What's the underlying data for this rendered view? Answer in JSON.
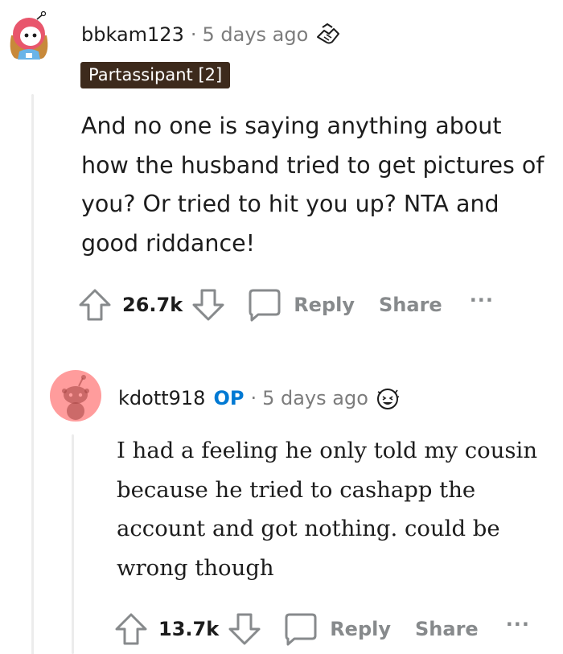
{
  "comments": [
    {
      "username": "bbkam123",
      "separator": "·",
      "timestamp": "5 days ago",
      "award_icon": "handshake-award-icon",
      "flair": "Partassipant [2]",
      "body": "And no one is saying anything about how the husband tried to get pictures of you? Or tried to hit you up? NTA and good riddance!",
      "score": "26.7k",
      "reply_label": "Reply",
      "share_label": "Share",
      "more_label": "···"
    },
    {
      "username": "kdott918",
      "op_badge": "OP",
      "separator": "·",
      "timestamp": "5 days ago",
      "award_icon": "lol-award-icon",
      "body": "I had a feeling he only told my cousin because he tried to cashapp the account and got nothing. could be wrong though",
      "score": "13.7k",
      "reply_label": "Reply",
      "share_label": "Share",
      "more_label": "···"
    }
  ],
  "colors": {
    "flair_bg": "#3d2a1c",
    "op_blue": "#0079d3",
    "muted": "#7c7c7c",
    "action_gray": "#878a8c",
    "thread_line": "#ececec",
    "avatar2_bg": "#ff9c9c"
  }
}
